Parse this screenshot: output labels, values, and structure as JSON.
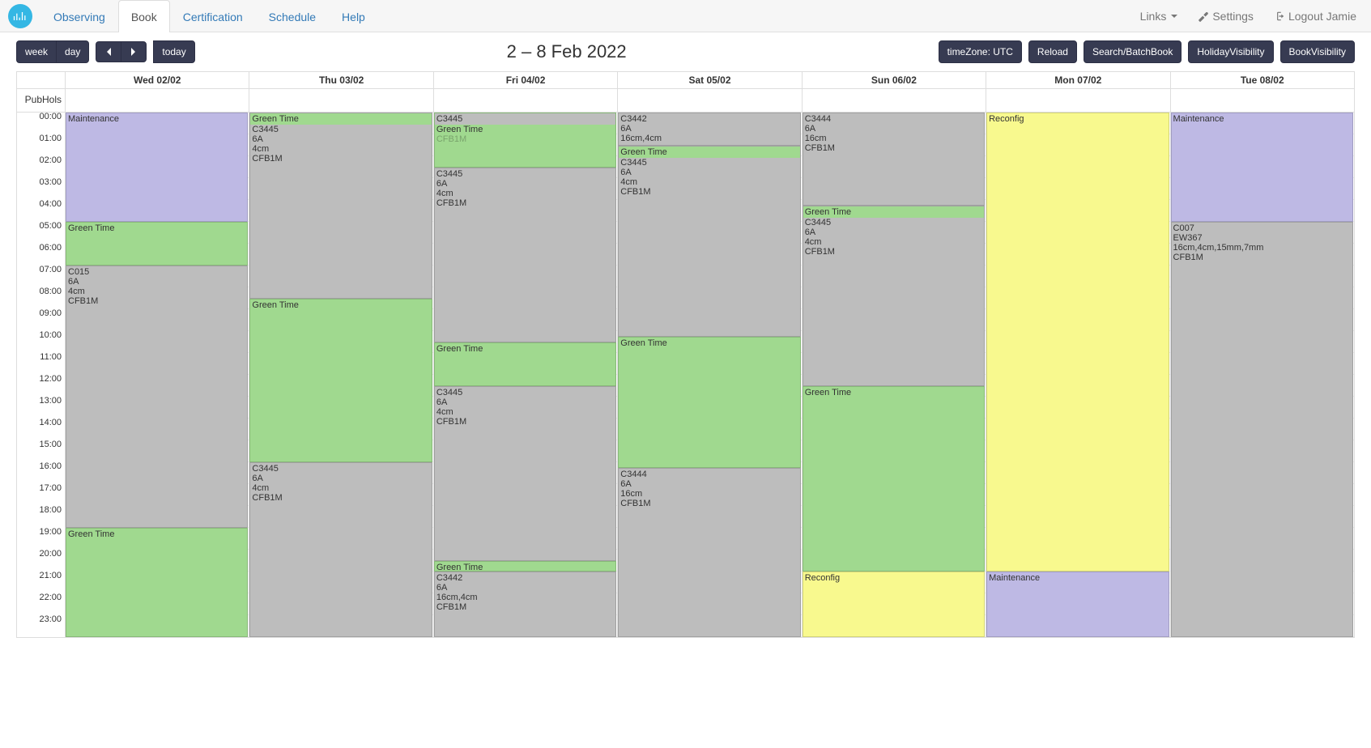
{
  "nav": {
    "tabs": [
      "Observing",
      "Book",
      "Certification",
      "Schedule",
      "Help"
    ],
    "active": 1,
    "links_label": "Links",
    "settings_label": "Settings",
    "logout_label": "Logout Jamie"
  },
  "toolbar": {
    "view_buttons": [
      "week",
      "day"
    ],
    "today_label": "today",
    "title": "2 – 8 Feb 2022",
    "right_buttons": [
      "timeZone: UTC",
      "Reload",
      "Search/BatchBook",
      "HolidayVisibility",
      "BookVisibility"
    ]
  },
  "calendar": {
    "allday_label": "PubHols",
    "days": [
      "Wed 02/02",
      "Thu 03/02",
      "Fri 04/02",
      "Sat 05/02",
      "Sun 06/02",
      "Mon 07/02",
      "Tue 08/02"
    ],
    "hours": [
      "00:00",
      "01:00",
      "02:00",
      "03:00",
      "04:00",
      "05:00",
      "06:00",
      "07:00",
      "08:00",
      "09:00",
      "10:00",
      "11:00",
      "12:00",
      "13:00",
      "14:00",
      "15:00",
      "16:00",
      "17:00",
      "18:00",
      "19:00",
      "20:00",
      "21:00",
      "22:00",
      "23:00"
    ],
    "events": [
      {
        "day": 0,
        "start": 0.0,
        "end": 5.0,
        "color": "lavender",
        "lines": [
          "Maintenance"
        ]
      },
      {
        "day": 0,
        "start": 5.0,
        "end": 7.0,
        "color": "green",
        "lines": [
          "Green Time"
        ]
      },
      {
        "day": 0,
        "start": 7.0,
        "end": 19.0,
        "color": "grey",
        "lines": [
          "C015",
          "6A",
          "4cm",
          "CFB1M"
        ]
      },
      {
        "day": 0,
        "start": 19.0,
        "end": 24.0,
        "color": "green",
        "lines": [
          "Green Time"
        ]
      },
      {
        "day": 1,
        "start": 0.0,
        "end": 8.5,
        "color": "grey",
        "lines": [
          "Green Time",
          "C3445",
          "6A",
          "4cm",
          "CFB1M"
        ],
        "first_green": true
      },
      {
        "day": 1,
        "start": 8.5,
        "end": 16.0,
        "color": "green",
        "lines": [
          "Green Time"
        ]
      },
      {
        "day": 1,
        "start": 16.0,
        "end": 24.0,
        "color": "grey",
        "lines": [
          "C3445",
          "6A",
          "4cm",
          "CFB1M"
        ]
      },
      {
        "day": 2,
        "start": 0.0,
        "end": 2.5,
        "color": "green",
        "lines": [
          "C3445",
          "Green Time"
        ],
        "first_grey": true,
        "dim_extra": true
      },
      {
        "day": 2,
        "start": 2.5,
        "end": 10.5,
        "color": "grey",
        "lines": [
          "C3445",
          "6A",
          "4cm",
          "CFB1M"
        ]
      },
      {
        "day": 2,
        "start": 10.5,
        "end": 12.5,
        "color": "green",
        "lines": [
          "Green Time"
        ]
      },
      {
        "day": 2,
        "start": 12.5,
        "end": 20.5,
        "color": "grey",
        "lines": [
          "C3445",
          "6A",
          "4cm",
          "CFB1M"
        ]
      },
      {
        "day": 2,
        "start": 20.5,
        "end": 21.0,
        "color": "green",
        "lines": [
          "Green Time"
        ]
      },
      {
        "day": 2,
        "start": 21.0,
        "end": 24.0,
        "color": "grey",
        "lines": [
          "C3442",
          "6A",
          "16cm,4cm",
          "CFB1M"
        ]
      },
      {
        "day": 3,
        "start": 0.0,
        "end": 1.5,
        "color": "grey",
        "lines": [
          "C3442",
          "6A",
          "16cm,4cm"
        ]
      },
      {
        "day": 3,
        "start": 1.5,
        "end": 10.25,
        "color": "grey",
        "lines": [
          "Green Time",
          "C3445",
          "6A",
          "4cm",
          "CFB1M"
        ],
        "first_green": true
      },
      {
        "day": 3,
        "start": 10.25,
        "end": 16.25,
        "color": "green",
        "lines": [
          "Green Time"
        ]
      },
      {
        "day": 3,
        "start": 16.25,
        "end": 24.0,
        "color": "grey",
        "lines": [
          "C3444",
          "6A",
          "16cm",
          "CFB1M"
        ]
      },
      {
        "day": 4,
        "start": 0.0,
        "end": 4.25,
        "color": "grey",
        "lines": [
          "C3444",
          "6A",
          "16cm",
          "CFB1M"
        ]
      },
      {
        "day": 4,
        "start": 4.25,
        "end": 12.5,
        "color": "grey",
        "lines": [
          "Green Time",
          "C3445",
          "6A",
          "4cm",
          "CFB1M"
        ],
        "first_green": true
      },
      {
        "day": 4,
        "start": 12.5,
        "end": 21.0,
        "color": "green",
        "lines": [
          "Green Time"
        ]
      },
      {
        "day": 4,
        "start": 21.0,
        "end": 24.0,
        "color": "yellow",
        "lines": [
          "Reconfig"
        ]
      },
      {
        "day": 5,
        "start": 0.0,
        "end": 21.0,
        "color": "yellow",
        "lines": [
          "Reconfig"
        ]
      },
      {
        "day": 5,
        "start": 21.0,
        "end": 24.0,
        "color": "lavender",
        "lines": [
          "Maintenance"
        ]
      },
      {
        "day": 6,
        "start": 0.0,
        "end": 5.0,
        "color": "lavender",
        "lines": [
          "Maintenance"
        ]
      },
      {
        "day": 6,
        "start": 5.0,
        "end": 24.0,
        "color": "grey",
        "lines": [
          "C007",
          "EW367",
          "16cm,4cm,15mm,7mm",
          "CFB1M"
        ]
      }
    ]
  }
}
